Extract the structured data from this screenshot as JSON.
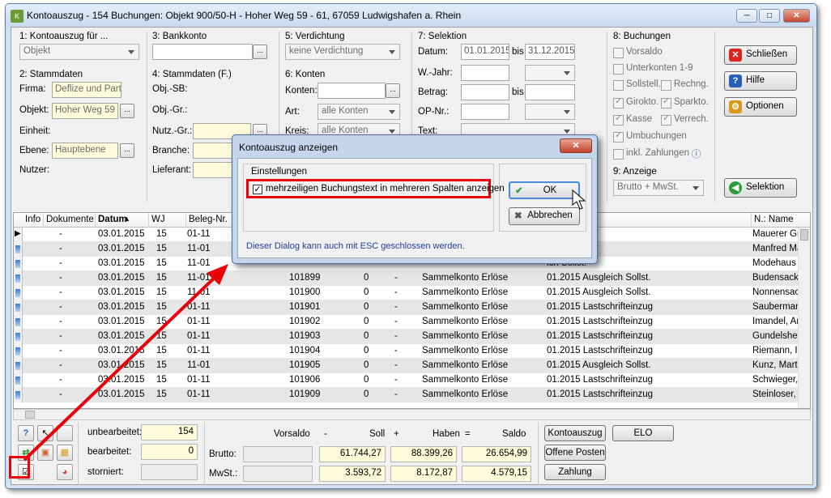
{
  "window": {
    "title": "Kontoauszug - 154 Buchungen:  Objekt 900/50-H - Hoher Weg 59 - 61, 67059 Ludwigshafen a. Rhein",
    "app_icon": "app-icon",
    "min": "─",
    "max": "□",
    "close": "✕"
  },
  "g1": {
    "title": "1: Kontoauszug für ...",
    "value": "Objekt"
  },
  "g2": {
    "title": "2: Stammdaten",
    "firma_label": "Firma:",
    "firma": "Deflize und Part",
    "objekt_label": "Objekt:",
    "objekt": "Hoher Weg 59 ·",
    "einheit_label": "Einheit:",
    "ebene_label": "Ebene:",
    "ebene": "Hauptebene",
    "nutzer_label": "Nutzer:"
  },
  "g3": {
    "title": "3: Bankkonto"
  },
  "g4": {
    "title": "4: Stammdaten (F.)",
    "objsb": "Obj.-SB:",
    "objgr": "Obj.-Gr.:",
    "nutzgr": "Nutz.-Gr.:",
    "branche": "Branche:",
    "lieferant": "Lieferant:"
  },
  "g5": {
    "title": "5: Verdichtung",
    "value": "keine Verdichtung"
  },
  "g6": {
    "title": "6: Konten",
    "konten": "Konten:",
    "art": "Art:",
    "art_value": "alle Konten",
    "kreis": "Kreis:",
    "kreis_value": "alle Konten"
  },
  "g7": {
    "title": "7: Selektion",
    "datum": "Datum:",
    "from": "01.01.2015",
    "bis": "bis",
    "to": "31.12.2015",
    "wjahr": "W.-Jahr:",
    "betrag": "Betrag:",
    "bis2": "bis",
    "opnr": "OP-Nr.:",
    "text": "Text:"
  },
  "g8": {
    "title": "8: Buchungen",
    "vorsaldo": "Vorsaldo",
    "unterkonten": "Unterkonten 1-9",
    "sollstell": "Sollstell.",
    "rechng": "Rechng.",
    "girokto": "Girokto.",
    "sparkto": "Sparkto.",
    "kasse": "Kasse",
    "verrech": "Verrech.",
    "umbuchungen": "Umbuchungen",
    "inkl": "inkl. Zahlungen",
    "info_icon": "ⓘ"
  },
  "g9": {
    "title": "9: Anzeige",
    "value": "Brutto + MwSt."
  },
  "buttons": {
    "schliessen": "Schließen",
    "hilfe": "Hilfe",
    "optionen": "Optionen",
    "selektion": "Selektion"
  },
  "grid": {
    "headers": {
      "info": "Info",
      "dokumente": "Dokumente",
      "datum": "Datum",
      "wj": "WJ",
      "beleg": "Beleg-Nr.",
      "name": "N.: Name"
    },
    "rows": [
      {
        "dok": "-",
        "datum": "03.01.2015",
        "wj": "15",
        "beleg": "01-11",
        "nr": "",
        "c0": "",
        "d": "",
        "konto": "",
        "text": ".2015",
        "name": "Mauerer Gm"
      },
      {
        "dok": "-",
        "datum": "03.01.2015",
        "wj": "15",
        "beleg": "11-01",
        "nr": "",
        "c0": "",
        "d": "",
        "konto": "",
        "text": "ich Sollst.",
        "name": "Manfred Ma"
      },
      {
        "dok": "-",
        "datum": "03.01.2015",
        "wj": "15",
        "beleg": "11-01",
        "nr": "",
        "c0": "",
        "d": "",
        "konto": "",
        "text": "ich Sollst.",
        "name": "Modehaus S"
      },
      {
        "dok": "-",
        "datum": "03.01.2015",
        "wj": "15",
        "beleg": "11-01",
        "nr": "101899",
        "c0": "0",
        "d": "-",
        "konto": "Sammelkonto Erlöse",
        "text": "01.2015 Ausgleich Sollst.",
        "name": "Budensack I"
      },
      {
        "dok": "-",
        "datum": "03.01.2015",
        "wj": "15",
        "beleg": "11-01",
        "nr": "101900",
        "c0": "0",
        "d": "-",
        "konto": "Sammelkonto Erlöse",
        "text": "01.2015 Ausgleich Sollst.",
        "name": "Nonnensack"
      },
      {
        "dok": "-",
        "datum": "03.01.2015",
        "wj": "15",
        "beleg": "01-11",
        "nr": "101901",
        "c0": "0",
        "d": "-",
        "konto": "Sammelkonto Erlöse",
        "text": "01.2015 Lastschrifteinzug",
        "name": "Saubermann"
      },
      {
        "dok": "-",
        "datum": "03.01.2015",
        "wj": "15",
        "beleg": "01-11",
        "nr": "101902",
        "c0": "0",
        "d": "-",
        "konto": "Sammelkonto Erlöse",
        "text": "01.2015 Lastschrifteinzug",
        "name": "Imandel, And"
      },
      {
        "dok": "-",
        "datum": "03.01.2015",
        "wj": "15",
        "beleg": "01-11",
        "nr": "101903",
        "c0": "0",
        "d": "-",
        "konto": "Sammelkonto Erlöse",
        "text": "01.2015 Lastschrifteinzug",
        "name": "Gundelsheim"
      },
      {
        "dok": "-",
        "datum": "03.01.2015",
        "wj": "15",
        "beleg": "01-11",
        "nr": "101904",
        "c0": "0",
        "d": "-",
        "konto": "Sammelkonto Erlöse",
        "text": "01.2015 Lastschrifteinzug",
        "name": "Riemann, Im"
      },
      {
        "dok": "-",
        "datum": "03.01.2015",
        "wj": "15",
        "beleg": "11-01",
        "nr": "101905",
        "c0": "0",
        "d": "-",
        "konto": "Sammelkonto Erlöse",
        "text": "01.2015 Ausgleich Sollst.",
        "name": "Kunz, Martin"
      },
      {
        "dok": "-",
        "datum": "03.01.2015",
        "wj": "15",
        "beleg": "01-11",
        "nr": "101906",
        "c0": "0",
        "d": "-",
        "konto": "Sammelkonto Erlöse",
        "text": "01.2015 Lastschrifteinzug",
        "name": "Schwieger, A"
      },
      {
        "dok": "-",
        "datum": "03.01.2015",
        "wj": "15",
        "beleg": "01-11",
        "nr": "101909",
        "c0": "0",
        "d": "-",
        "konto": "Sammelkonto Erlöse",
        "text": "01.2015 Lastschrifteinzug",
        "name": "Steinloser, M"
      }
    ]
  },
  "summary": {
    "unbearbeitet_label": "unbearbeitet:",
    "unbearbeitet": "154",
    "bearbeitet_label": "bearbeitet:",
    "bearbeitet": "0",
    "storniert_label": "storniert:",
    "vorsaldo": "Vorsaldo",
    "minus": "-",
    "soll": "Soll",
    "plus": "+",
    "haben": "Haben",
    "eq": "=",
    "saldo": "Saldo",
    "brutto_label": "Brutto:",
    "brutto_soll": "61.744,27",
    "brutto_haben": "88.399,26",
    "brutto_saldo": "26.654,99",
    "mwst_label": "MwSt.:",
    "mwst_soll": "3.593,72",
    "mwst_haben": "8.172,87",
    "mwst_saldo": "4.579,15"
  },
  "bottom_buttons": {
    "kontoauszug": "Kontoauszug",
    "elo": "ELO",
    "offene": "Offene Posten",
    "zahlung": "Zahlung"
  },
  "dialog": {
    "title": "Kontoauszug anzeigen",
    "close": "✕",
    "group": "Einstellungen",
    "checkbox": "mehrzeiligen Buchungstext in mehreren Spalten anzeigen",
    "ok": "OK",
    "abbrechen": "Abbrechen",
    "hint": "Dieser Dialog kann auch mit ESC geschlossen werden."
  },
  "colors": {
    "annotation": "#e8000a",
    "hint_text": "#1d3f9c",
    "accent": "#3a7cd6"
  }
}
